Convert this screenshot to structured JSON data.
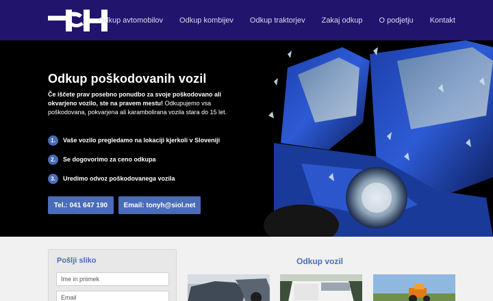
{
  "header": {
    "logo_text": "TH",
    "nav": [
      "Odkup avtomobilov",
      "Odkup kombijev",
      "Odkup traktorjev",
      "Zakaj odkup",
      "O podjetju",
      "Kontakt"
    ]
  },
  "hero": {
    "title": "Odkup poškodovanih vozil",
    "desc_bold": "Če iščete prav posebno ponudbo za svoje poškodovano ali okvarjeno vozilo, ste na pravem mestu!",
    "desc_rest": " Odkupujemo vsa poškodovana, pokvarjena ali karambolirana vozila stara do 15 let.",
    "steps": [
      {
        "num": "1.",
        "text": "Vaše vozilo pregledamo na lokaciji kjerkoli v Sloveniji"
      },
      {
        "num": "2.",
        "text": "Se dogovorimo za ceno odkupa"
      },
      {
        "num": "3.",
        "text": "Uredimo odvoz poškodovanega vozila"
      }
    ],
    "tel_button": "Tel.: 041 647 190",
    "email_button": "Email: tonyh@siol.net"
  },
  "form": {
    "title": "Pošlji sliko",
    "name_placeholder": "Ime in priimek",
    "email_placeholder": "Email"
  },
  "gallery": {
    "title": "Odkup vozil"
  },
  "colors": {
    "header_bg": "#21146d",
    "accent": "#4b6cb7"
  }
}
